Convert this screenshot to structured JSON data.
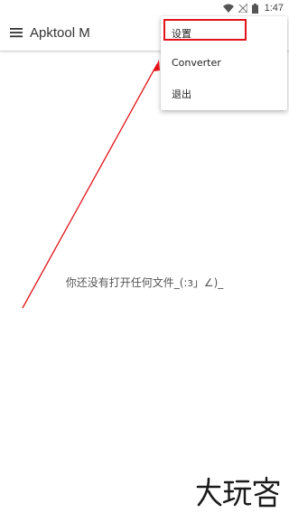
{
  "status_bar": {
    "time": "1:47",
    "icons": [
      "wifi-icon",
      "no-signal-icon",
      "battery-icon"
    ]
  },
  "app_bar": {
    "menu_icon": "hamburger-menu-icon",
    "title": "Apktool M"
  },
  "main": {
    "empty_message": "你还没有打开任何文件_(:з」∠)_"
  },
  "overflow_menu": {
    "items": [
      {
        "label": "设置"
      },
      {
        "label": "Converter"
      },
      {
        "label": "退出"
      }
    ],
    "highlighted_item": "设置"
  },
  "annotation": {
    "color": "#e2141b"
  },
  "watermark": {
    "text": "大玩客"
  }
}
